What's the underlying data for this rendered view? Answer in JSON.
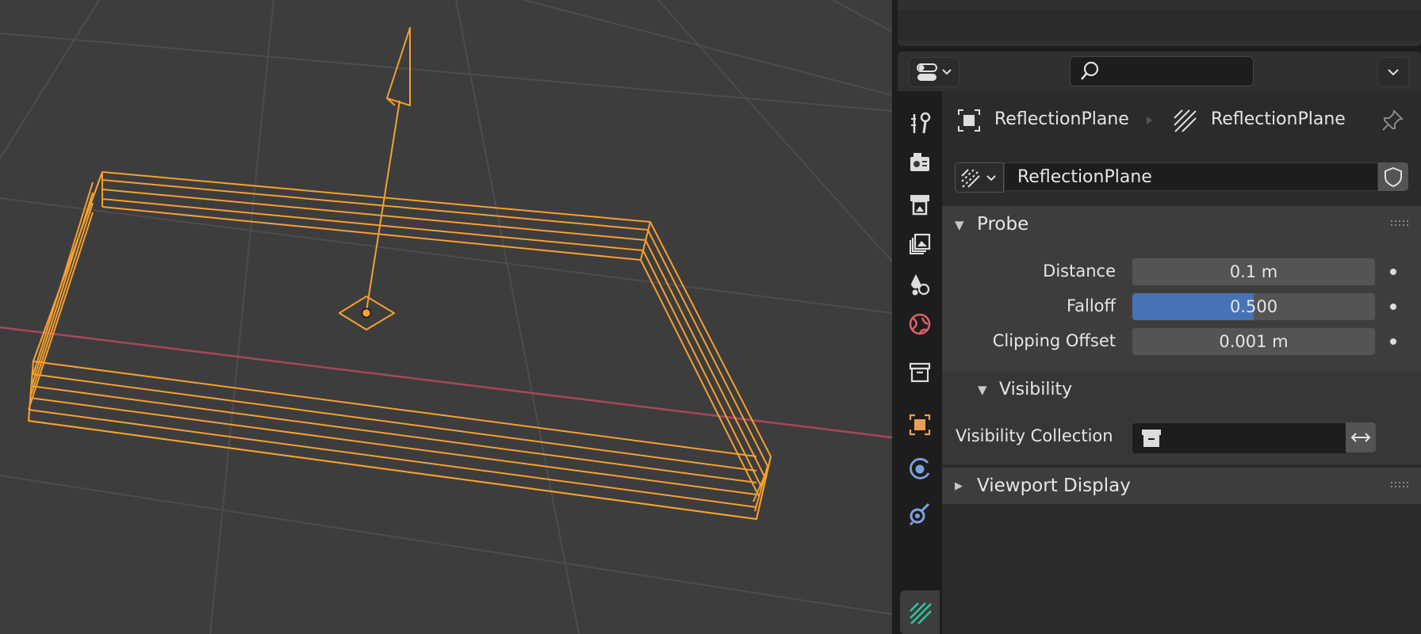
{
  "viewport": {
    "object_color": "#f5a030",
    "x_axis_color": "#a8475a",
    "grid_color": "#4d4d4d"
  },
  "header": {
    "editor_icon": "properties-editor-icon",
    "search": {
      "placeholder": "",
      "value": ""
    }
  },
  "breadcrumb": {
    "object_name": "ReflectionPlane",
    "data_name": "ReflectionPlane"
  },
  "datablock": {
    "name": "ReflectionPlane"
  },
  "tabs": [
    "tool",
    "render",
    "output",
    "view-layer",
    "scene",
    "world",
    "collection",
    "object",
    "physics",
    "constraints",
    "data"
  ],
  "active_tab": "data",
  "probe_panel": {
    "title": "Probe",
    "distance": {
      "label": "Distance",
      "value": "0.1 m"
    },
    "falloff": {
      "label": "Falloff",
      "value": "0.500",
      "fraction": 0.5
    },
    "clipping_offset": {
      "label": "Clipping Offset",
      "value": "0.001 m"
    },
    "visibility": {
      "title": "Visibility",
      "collection_label": "Visibility Collection",
      "collection_value": ""
    }
  },
  "viewport_display_panel": {
    "title": "Viewport Display"
  }
}
